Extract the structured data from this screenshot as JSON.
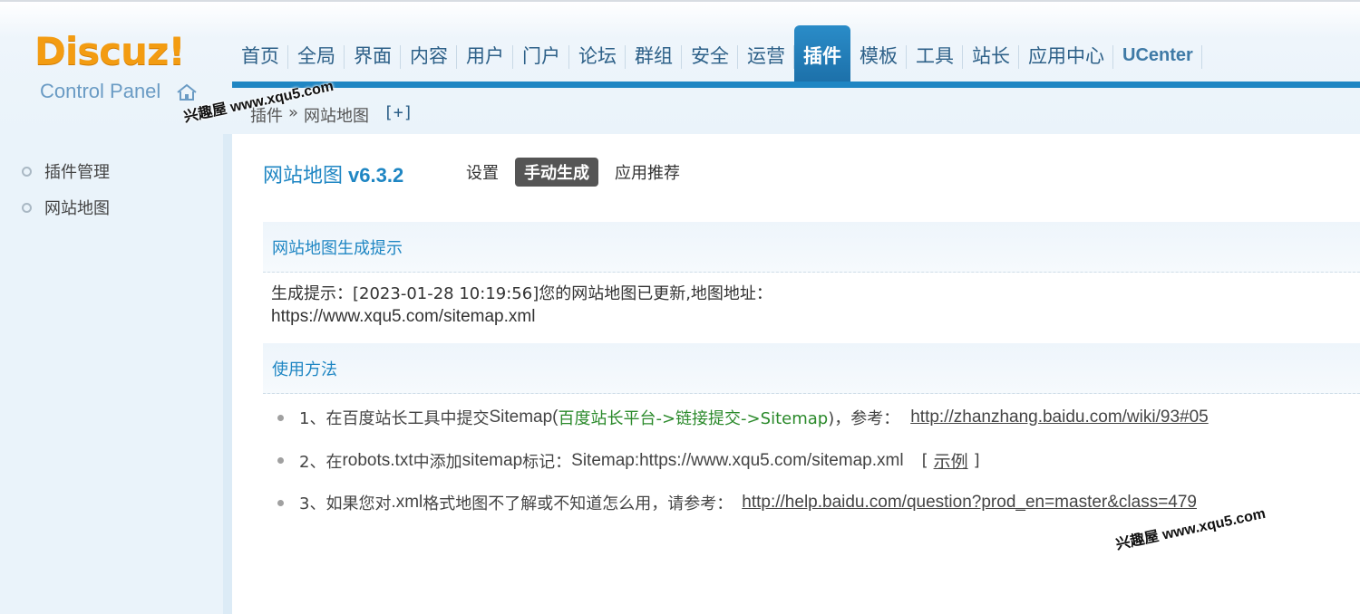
{
  "logo": {
    "main": "Discuz!",
    "sub": "Control Panel"
  },
  "nav": [
    "首页",
    "全局",
    "界面",
    "内容",
    "用户",
    "门户",
    "论坛",
    "群组",
    "安全",
    "运营",
    "插件",
    "模板",
    "工具",
    "站长",
    "应用中心",
    "UCenter"
  ],
  "nav_active": "插件",
  "breadcrumb": {
    "root": "插件",
    "sep": "»",
    "current": "网站地图",
    "add": "[+]"
  },
  "watermark": "兴趣屋 www.xqu5.com",
  "sidebar": {
    "items": [
      {
        "label": "插件管理"
      },
      {
        "label": "网站地图"
      }
    ]
  },
  "plugin": {
    "name": "网站地图",
    "version": "v6.3.2"
  },
  "tabs": [
    {
      "label": "设置"
    },
    {
      "label": "手动生成"
    },
    {
      "label": "应用推荐"
    }
  ],
  "sections": {
    "tip": {
      "title": "网站地图生成提示",
      "line1": "生成提示：[2023-01-28 10:19:56]您的网站地图已更新,地图地址：",
      "url": "https://www.xqu5.com/sitemap.xml"
    },
    "usage": {
      "title": "使用方法",
      "item1": {
        "num": "1、",
        "text": "在百度站长工具中提交",
        "sm": "Sitemap(",
        "green": "百度站长平台->链接提交->Sitemap",
        "tail": ")，参考：",
        "link": "http://zhanzhang.baidu.com/wiki/93#05"
      },
      "item2": {
        "num": "2、",
        "text1": "在",
        "robots": "robots.txt",
        "text2": "中添加",
        "sitemap": "sitemap",
        "text3": "标记：",
        "line": "Sitemap:https://www.xqu5.com/sitemap.xml",
        "ex_open": "[",
        "example": "示例",
        "ex_close": "]"
      },
      "item3": {
        "num": "3、",
        "text1": "如果您对",
        "xml": ".xml",
        "text2": "格式地图不了解或不知道怎么用，请参考：",
        "link": "http://help.baidu.com/question?prod_en=master&class=479"
      }
    }
  },
  "colors": {
    "accent": "#1f86c3",
    "logo": "#f39c12",
    "active_tab": "#555555",
    "green": "#2b8a2b"
  }
}
